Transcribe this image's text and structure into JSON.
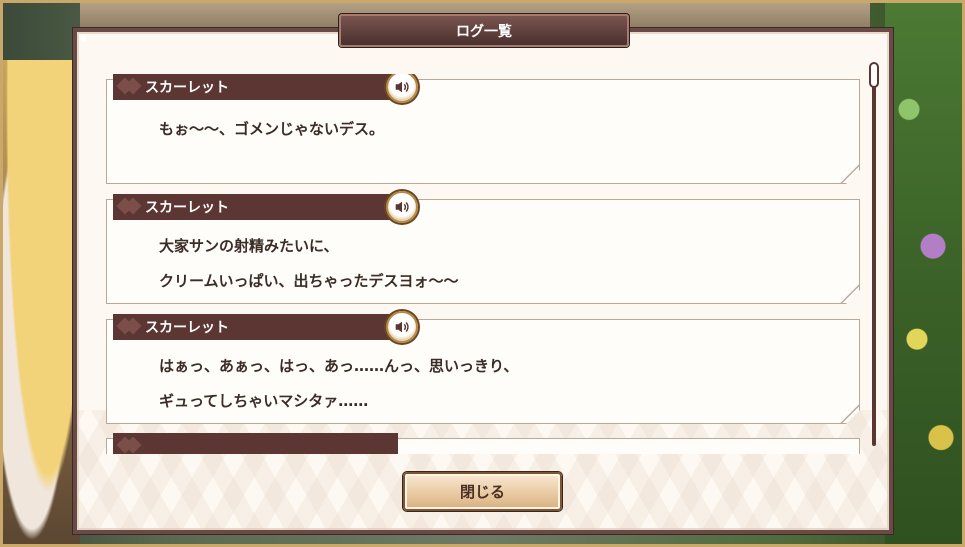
{
  "dialog": {
    "title": "ログ一覧",
    "close_label": "閉じる"
  },
  "log": {
    "entries": [
      {
        "speaker": "スカーレット",
        "lines": [
          "もぉ〜〜、ゴメンじゃないデス。"
        ]
      },
      {
        "speaker": "スカーレット",
        "lines": [
          "大家サンの射精みたいに、",
          "クリームいっぱい、出ちゃったデスヨォ〜〜"
        ]
      },
      {
        "speaker": "スカーレット",
        "lines": [
          "はぁっ、あぁっ、はっ、あっ……んっ、思いっきり、",
          "ギュってしちゃいマシタァ……"
        ]
      },
      {
        "speaker": "",
        "lines": []
      }
    ]
  },
  "icons": {
    "voice": "speaker-icon"
  },
  "colors": {
    "frame": "#6a4a46",
    "name_bar": "#5b3633",
    "panel_bg": "#fdf8f1",
    "text": "#3b2c26"
  }
}
